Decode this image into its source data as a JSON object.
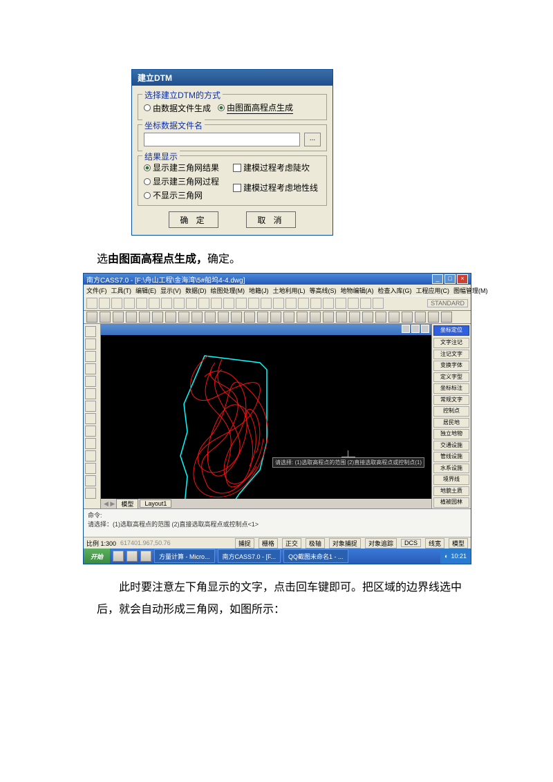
{
  "dlg": {
    "title": "建立DTM",
    "grp1_label": "选择建立DTM的方式",
    "opt_file": "由数据文件生成",
    "opt_map": "由图面高程点生成",
    "grp2_label": "坐标数据文件名",
    "browse": "...",
    "grp3_label": "结果显示",
    "r1": "显示建三角网结果",
    "r2": "显示建三角网过程",
    "r3": "不显示三角网",
    "c1": "建模过程考虑陡坎",
    "c2": "建模过程考虑地性线",
    "ok": "确 定",
    "cancel": "取 消"
  },
  "para1_a": "选",
  "para1_b": "由图面高程点生成，",
  "para1_c": "确定。",
  "app": {
    "title_prefix": "南方CASS7.0 - [F:\\舟山工程\\金海湾\\5#船坞4-4.dwg]",
    "menus": [
      "文件(F)",
      "工具(T)",
      "编辑(E)",
      "显示(V)",
      "数据(D)",
      "绘图处理(M)",
      "地籍(J)",
      "土地利用(L)",
      "等高线(S)",
      "地物编辑(A)",
      "检查入库(G)",
      "工程应用(C)",
      "图幅管理(M)"
    ],
    "std_label": "STANDARD",
    "right_top": [
      "坐标定位",
      "文字注记",
      "注记文字",
      "变换字体",
      "定义字型",
      "坐标标注",
      "常规文字"
    ],
    "right_bottom": [
      "控制点",
      "居民地",
      "独立地物",
      "交通设施",
      "管线设施",
      "水系设施",
      "境界线",
      "地貌土质",
      "植被园林"
    ],
    "tooltip": "请选择: (1)选取高程点的范围 (2)直接选取高程点或控制点(1)",
    "model_tabs": [
      "模型",
      "Layout1"
    ],
    "cmd_line1": "命令:",
    "cmd_line2": "请选择：(1)选取高程点的范围 (2)直接选取高程点或控制点<1>",
    "status": {
      "scale": "比例 1:300",
      "coord": "617401.967,50.76",
      "items": [
        "捕捉",
        "栅格",
        "正交",
        "极轴",
        "对象捕捉",
        "对象追踪",
        "DCS",
        "线宽",
        "模型"
      ]
    },
    "start": "开始",
    "tasks": [
      "方量计算 - Micro...",
      "南方CASS7.0 - [F...",
      "QQ截图未命名1 - ..."
    ],
    "time": "10:21"
  },
  "para2": "此时要注意左下角显示的文字，点击回车键即可。把区域的边界线选中后，就会自动形成三角网，如图所示："
}
